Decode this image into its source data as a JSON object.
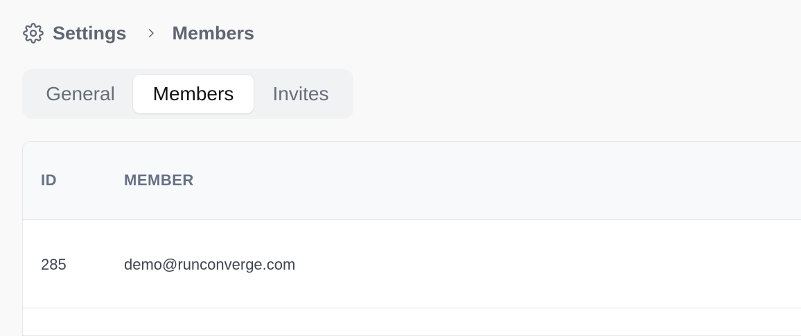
{
  "breadcrumb": {
    "icon": "gear-icon",
    "items": [
      "Settings",
      "Members"
    ],
    "separator_icon": "chevron-right-icon"
  },
  "tabs": [
    {
      "label": "General",
      "selected": false
    },
    {
      "label": "Members",
      "selected": true
    },
    {
      "label": "Invites",
      "selected": false
    }
  ],
  "table": {
    "columns": [
      "ID",
      "MEMBER"
    ],
    "rows": [
      [
        "285",
        "demo@runconverge.com"
      ]
    ]
  },
  "colors": {
    "page_background": "#f9f9f9",
    "text_muted": "#5f6673",
    "tab_selected_text": "#111111",
    "tab_track": "#f1f2f4",
    "table_header_background": "#f8f9fa",
    "table_border": "#e4e6ea"
  }
}
